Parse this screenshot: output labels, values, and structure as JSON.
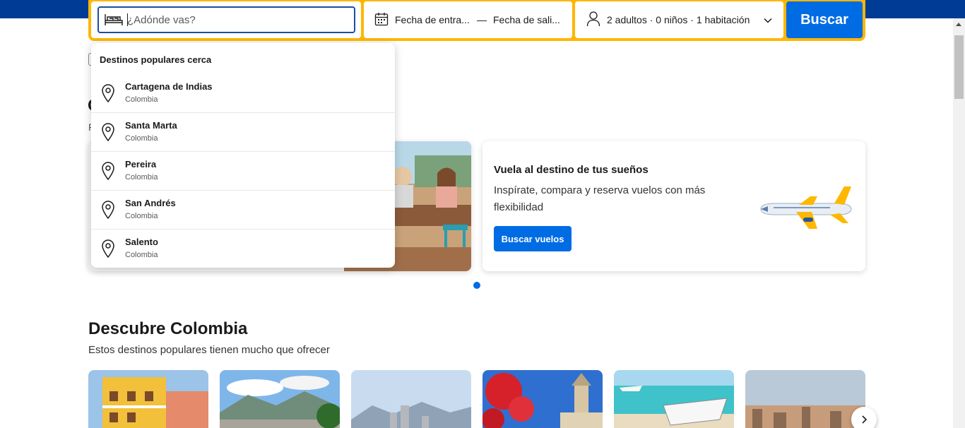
{
  "search": {
    "destination_placeholder": "¿Adónde vas?",
    "destination_value": "",
    "checkin_label": "Fecha de entra...",
    "date_separator": "—",
    "checkout_label": "Fecha de sali...",
    "guests_label": "2 adultos · 0 niños · 1 habitación",
    "search_button": "Buscar"
  },
  "dropdown": {
    "header": "Destinos populares cerca",
    "items": [
      {
        "name": "Cartagena de Indias",
        "country": "Colombia"
      },
      {
        "name": "Santa Marta",
        "country": "Colombia"
      },
      {
        "name": "Pereira",
        "country": "Colombia"
      },
      {
        "name": "San Andrés",
        "country": "Colombia"
      },
      {
        "name": "Salento",
        "country": "Colombia"
      }
    ]
  },
  "peek": {
    "heading_letter": "O",
    "sub_letter": "P"
  },
  "promo": {
    "title": "Vuela al destino de tus sueños",
    "description": "Inspírate, compara y reserva vuelos con más flexibilidad",
    "button": "Buscar vuelos"
  },
  "discover": {
    "title": "Descubre Colombia",
    "subtitle": "Estos destinos populares tienen mucho que ofrecer"
  },
  "icons": {
    "bed": "bed-icon",
    "calendar": "calendar-icon",
    "person": "person-icon",
    "chevron": "chevron-down-icon",
    "pin": "map-pin-icon",
    "plane": "airplane-icon",
    "next": "chevron-right-icon"
  },
  "colors": {
    "brand_dark_blue": "#003b95",
    "accent_yellow": "#ffb700",
    "primary_blue": "#006ce4"
  }
}
